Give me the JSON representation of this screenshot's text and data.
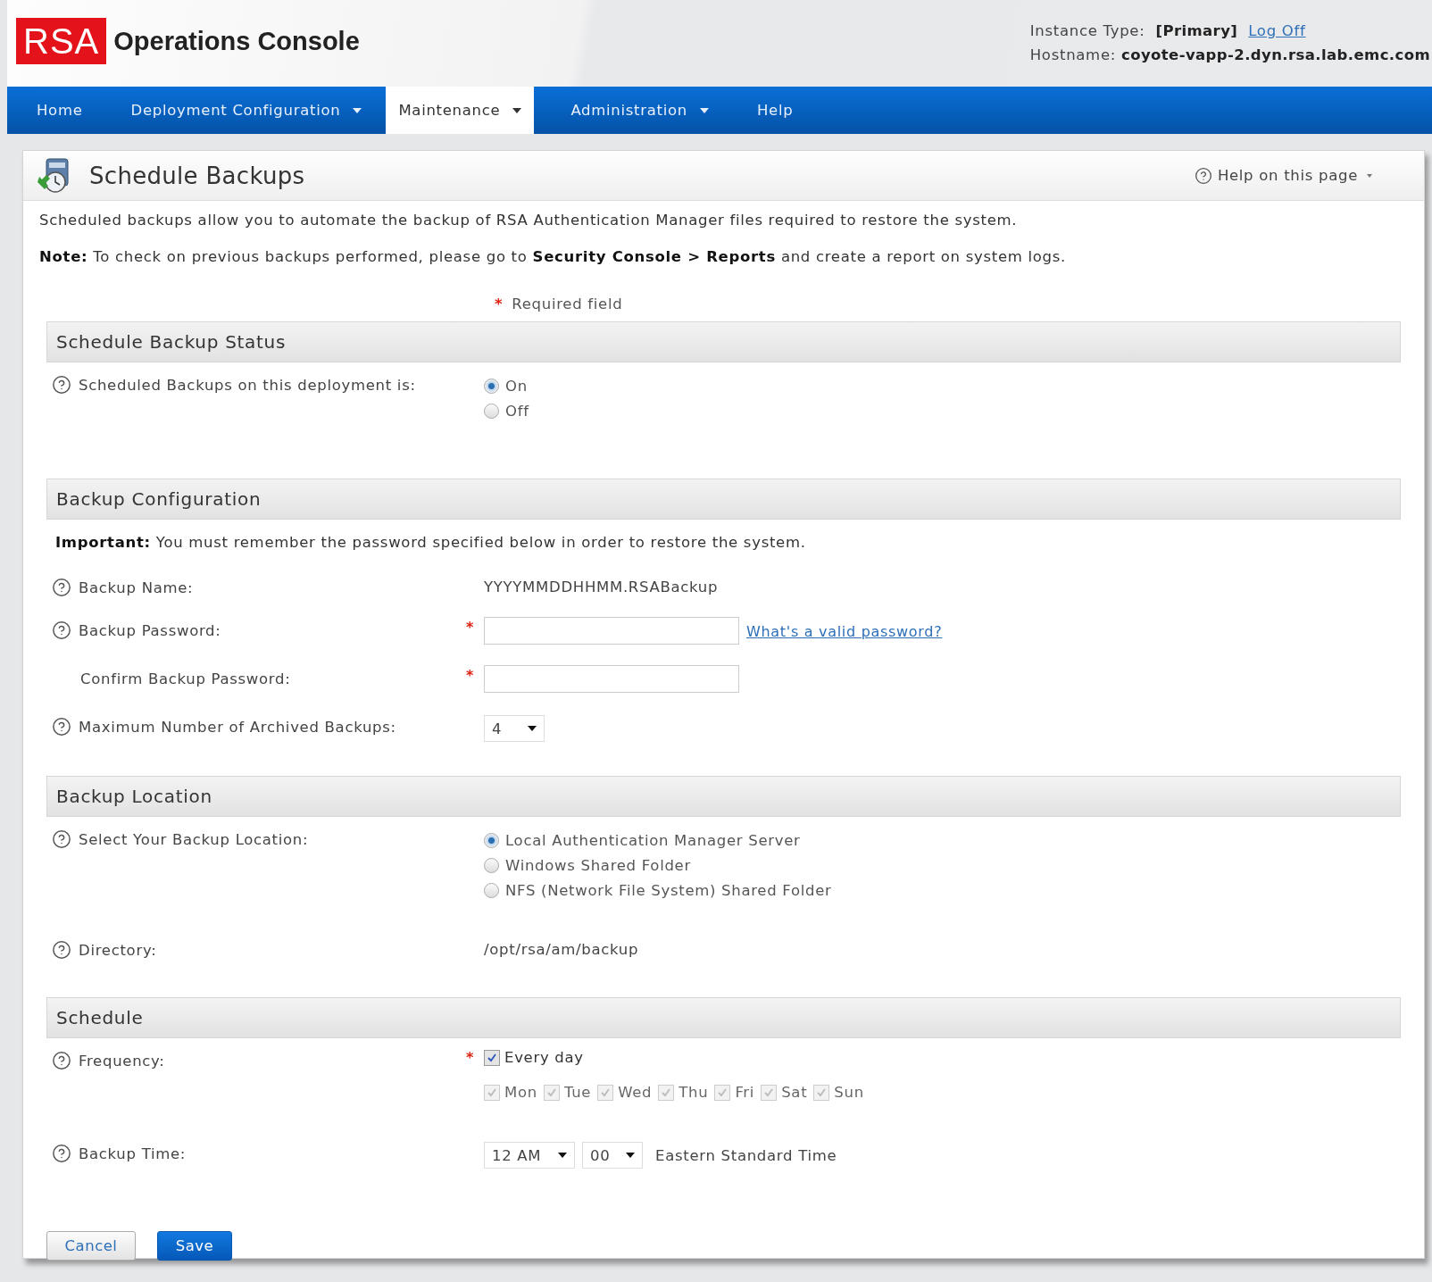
{
  "header": {
    "logo": "RSA",
    "title": "Operations Console",
    "instance_label": "Instance Type:",
    "instance_value": "[Primary]",
    "logoff": "Log Off",
    "hostname_label": "Hostname:",
    "hostname_value": "coyote-vapp-2.dyn.rsa.lab.emc.com"
  },
  "nav": [
    {
      "label": "Home",
      "dropdown": false,
      "selected": false
    },
    {
      "label": "Deployment Configuration",
      "dropdown": true,
      "selected": false
    },
    {
      "label": "Maintenance",
      "dropdown": true,
      "selected": true
    },
    {
      "label": "Administration",
      "dropdown": true,
      "selected": false
    },
    {
      "label": "Help",
      "dropdown": false,
      "selected": false
    }
  ],
  "page": {
    "title": "Schedule Backups",
    "help": "Help on this page"
  },
  "intro": "Scheduled backups allow you to automate the backup of RSA Authentication Manager files required to restore the system.",
  "note": "**Note:** To check on previous backups performed, please go to **Security Console > Reports** and create a report on system logs.",
  "required_legend": {
    "mark": "*",
    "text": "Required field"
  },
  "sections": [
    {
      "title": "Schedule Backup Status",
      "rows": [
        {
          "kind": "radio",
          "help": true,
          "label": "Scheduled Backups on this deployment is:",
          "options": [
            {
              "label": "On",
              "selected": true
            },
            {
              "label": "Off",
              "selected": false
            }
          ]
        }
      ]
    },
    {
      "title": "Backup Configuration",
      "notice": "**Important:** You must remember the password specified below in order to restore the system.",
      "rows": [
        {
          "kind": "text",
          "help": true,
          "label": "Backup Name:",
          "value": "YYYYMMDDHHMM.RSABackup"
        },
        {
          "kind": "password",
          "help": true,
          "label": "Backup Password:",
          "required_mark": "*",
          "link": "What's a valid password?"
        },
        {
          "kind": "password",
          "help": false,
          "label": "Confirm Backup Password:",
          "required_mark": "*"
        },
        {
          "kind": "select",
          "help": true,
          "label": "Maximum Number of Archived Backups:",
          "value": "4"
        }
      ]
    },
    {
      "title": "Backup Location",
      "rows": [
        {
          "kind": "radio",
          "help": true,
          "label": "Select Your Backup Location:",
          "options": [
            {
              "label": "Local Authentication Manager Server",
              "selected": true
            },
            {
              "label": "Windows Shared Folder",
              "selected": false
            },
            {
              "label": "NFS (Network File System) Shared Folder",
              "selected": false
            }
          ]
        },
        {
          "kind": "text",
          "help": true,
          "label": "Directory:",
          "value": "/opt/rsa/am/backup"
        }
      ]
    },
    {
      "title": "Schedule",
      "rows": [
        {
          "kind": "frequency",
          "help": true,
          "label": "Frequency:",
          "required_mark": "*",
          "every_day": {
            "label": "Every day",
            "checked": true
          },
          "days": [
            {
              "label": "Mon",
              "checked": true,
              "disabled": true
            },
            {
              "label": "Tue",
              "checked": true,
              "disabled": true
            },
            {
              "label": "Wed",
              "checked": true,
              "disabled": true
            },
            {
              "label": "Thu",
              "checked": true,
              "disabled": true
            },
            {
              "label": "Fri",
              "checked": true,
              "disabled": true
            },
            {
              "label": "Sat",
              "checked": true,
              "disabled": true
            },
            {
              "label": "Sun",
              "checked": true,
              "disabled": true
            }
          ]
        },
        {
          "kind": "time",
          "help": true,
          "label": "Backup Time:",
          "hour": "12 AM",
          "minute": "00",
          "zone": "Eastern Standard Time"
        }
      ]
    }
  ],
  "buttons": [
    {
      "label": "Cancel",
      "primary": false
    },
    {
      "label": "Save",
      "primary": true
    }
  ]
}
